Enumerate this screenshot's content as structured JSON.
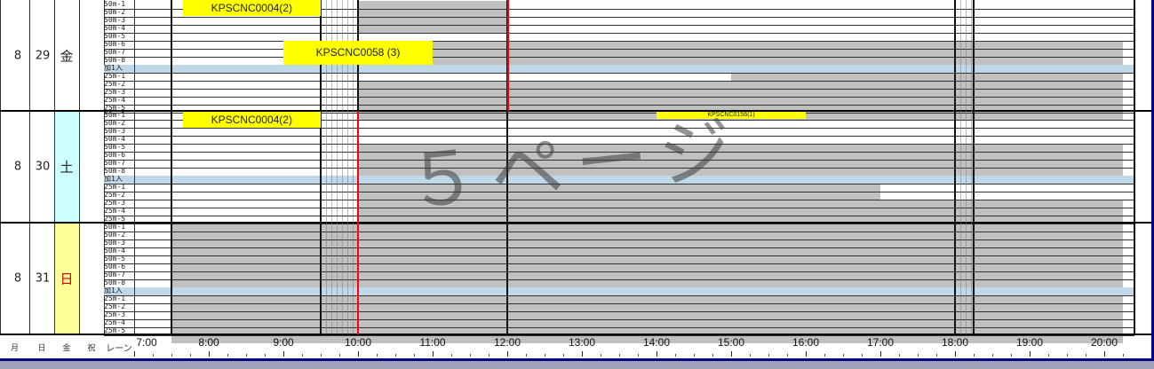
{
  "days": [
    {
      "month": "8",
      "day": "29",
      "weekday": "金",
      "weekday_color": "#ffffff",
      "weekday_text_color": "#222222"
    },
    {
      "month": "8",
      "day": "30",
      "weekday": "土",
      "weekday_color": "#ccffff",
      "weekday_text_color": "#222222"
    },
    {
      "month": "8",
      "day": "31",
      "weekday": "日",
      "weekday_color": "#ffff99",
      "weekday_text_color": "#cc0000"
    }
  ],
  "lane_labels": [
    "50m-1",
    "50m-2",
    "50m-3",
    "50m-4",
    "50m-5",
    "50m-6",
    "50m-7",
    "50m-8",
    "加1入",
    "25m-1",
    "25m-2",
    "25m-3",
    "25m-4",
    "25m-5"
  ],
  "jobs": [
    {
      "label": "KPSCNC0004(2)"
    },
    {
      "label": "KPSCNC0058 (3)"
    },
    {
      "label": "KPSCNC0004(2)"
    },
    {
      "label": "KPSCNC0156(1)"
    }
  ],
  "watermark": "５ページ",
  "footer": {
    "month": "月",
    "day": "日",
    "weekday": "金",
    "holiday": "祝",
    "lane": "レーン"
  },
  "time_labels": [
    "7:00",
    "8:00",
    "9:00",
    "10:00",
    "11:00",
    "12:00",
    "13:00",
    "14:00",
    "15:00",
    "16:00",
    "17:00",
    "18:00",
    "19:00",
    "20:00"
  ],
  "colors": {
    "grid": "#333333",
    "blocked": "#c0c0c0",
    "job": "#ffff00",
    "current_time_line": "#ff0000",
    "separator_row": "#c0d8e8",
    "page_border": "#000080"
  }
}
